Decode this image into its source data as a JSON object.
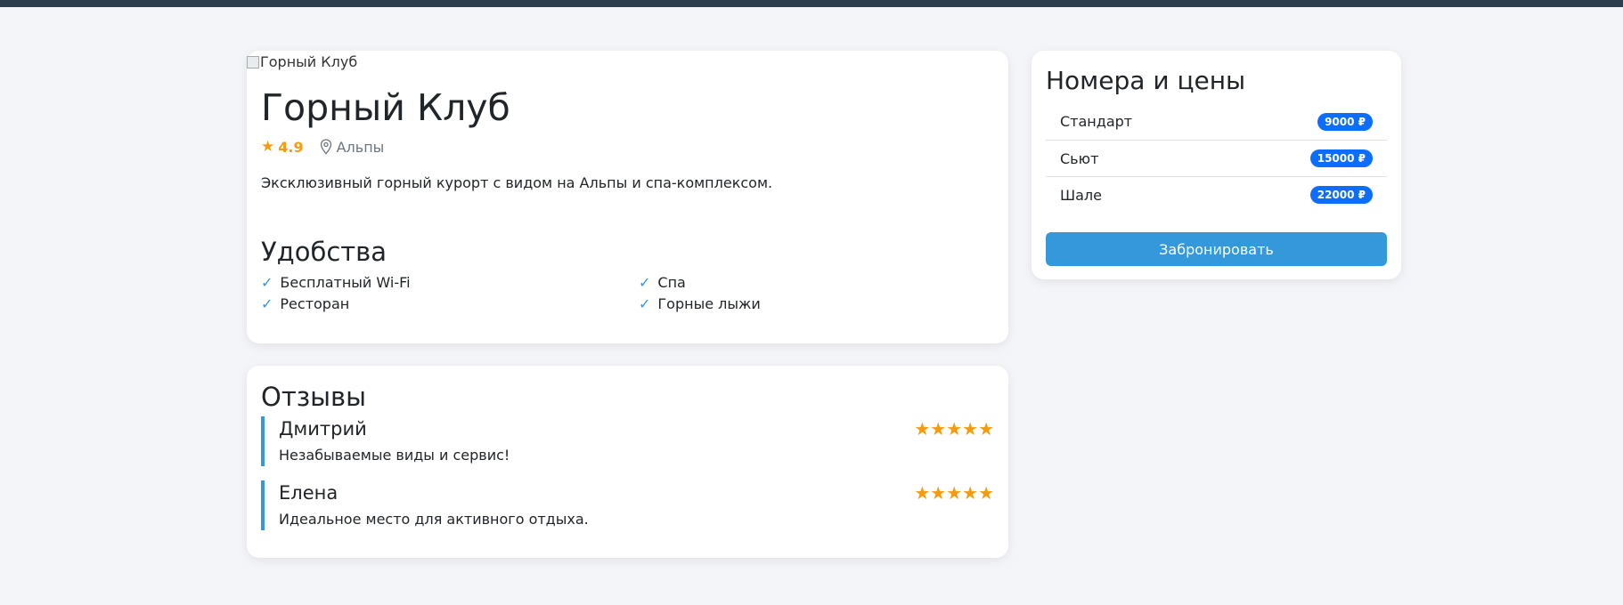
{
  "hotel": {
    "image_alt": "Горный Клуб",
    "title": "Горный Клуб",
    "rating": "4.9",
    "location": "Альпы",
    "description": "Эксклюзивный горный курорт с видом на Альпы и спа-комплексом.",
    "icons": {
      "rating": "star-icon",
      "location": "map-pin-icon"
    }
  },
  "amenities": {
    "title": "Удобства",
    "check_glyph": "✓",
    "items": [
      "Бесплатный Wi-Fi",
      "Спа",
      "Ресторан",
      "Горные лыжи"
    ]
  },
  "reviews": {
    "title": "Отзывы",
    "items": [
      {
        "author": "Дмитрий",
        "text": "Незабываемые виды и сервис!",
        "stars": 5,
        "stars_text": "★★★★★"
      },
      {
        "author": "Елена",
        "text": "Идеальное место для активного отдыха.",
        "stars": 5,
        "stars_text": "★★★★★"
      }
    ]
  },
  "rooms": {
    "title": "Номера и цены",
    "items": [
      {
        "name": "Стандарт",
        "price": "9000 ₽"
      },
      {
        "name": "Сьют",
        "price": "15000 ₽"
      },
      {
        "name": "Шале",
        "price": "22000 ₽"
      }
    ],
    "book_label": "Забронировать"
  },
  "colors": {
    "accent": "#3498db",
    "badge": "#0d6efd",
    "star": "#f39c12",
    "topbar": "#2c3e50",
    "background": "#f4f5f8"
  }
}
